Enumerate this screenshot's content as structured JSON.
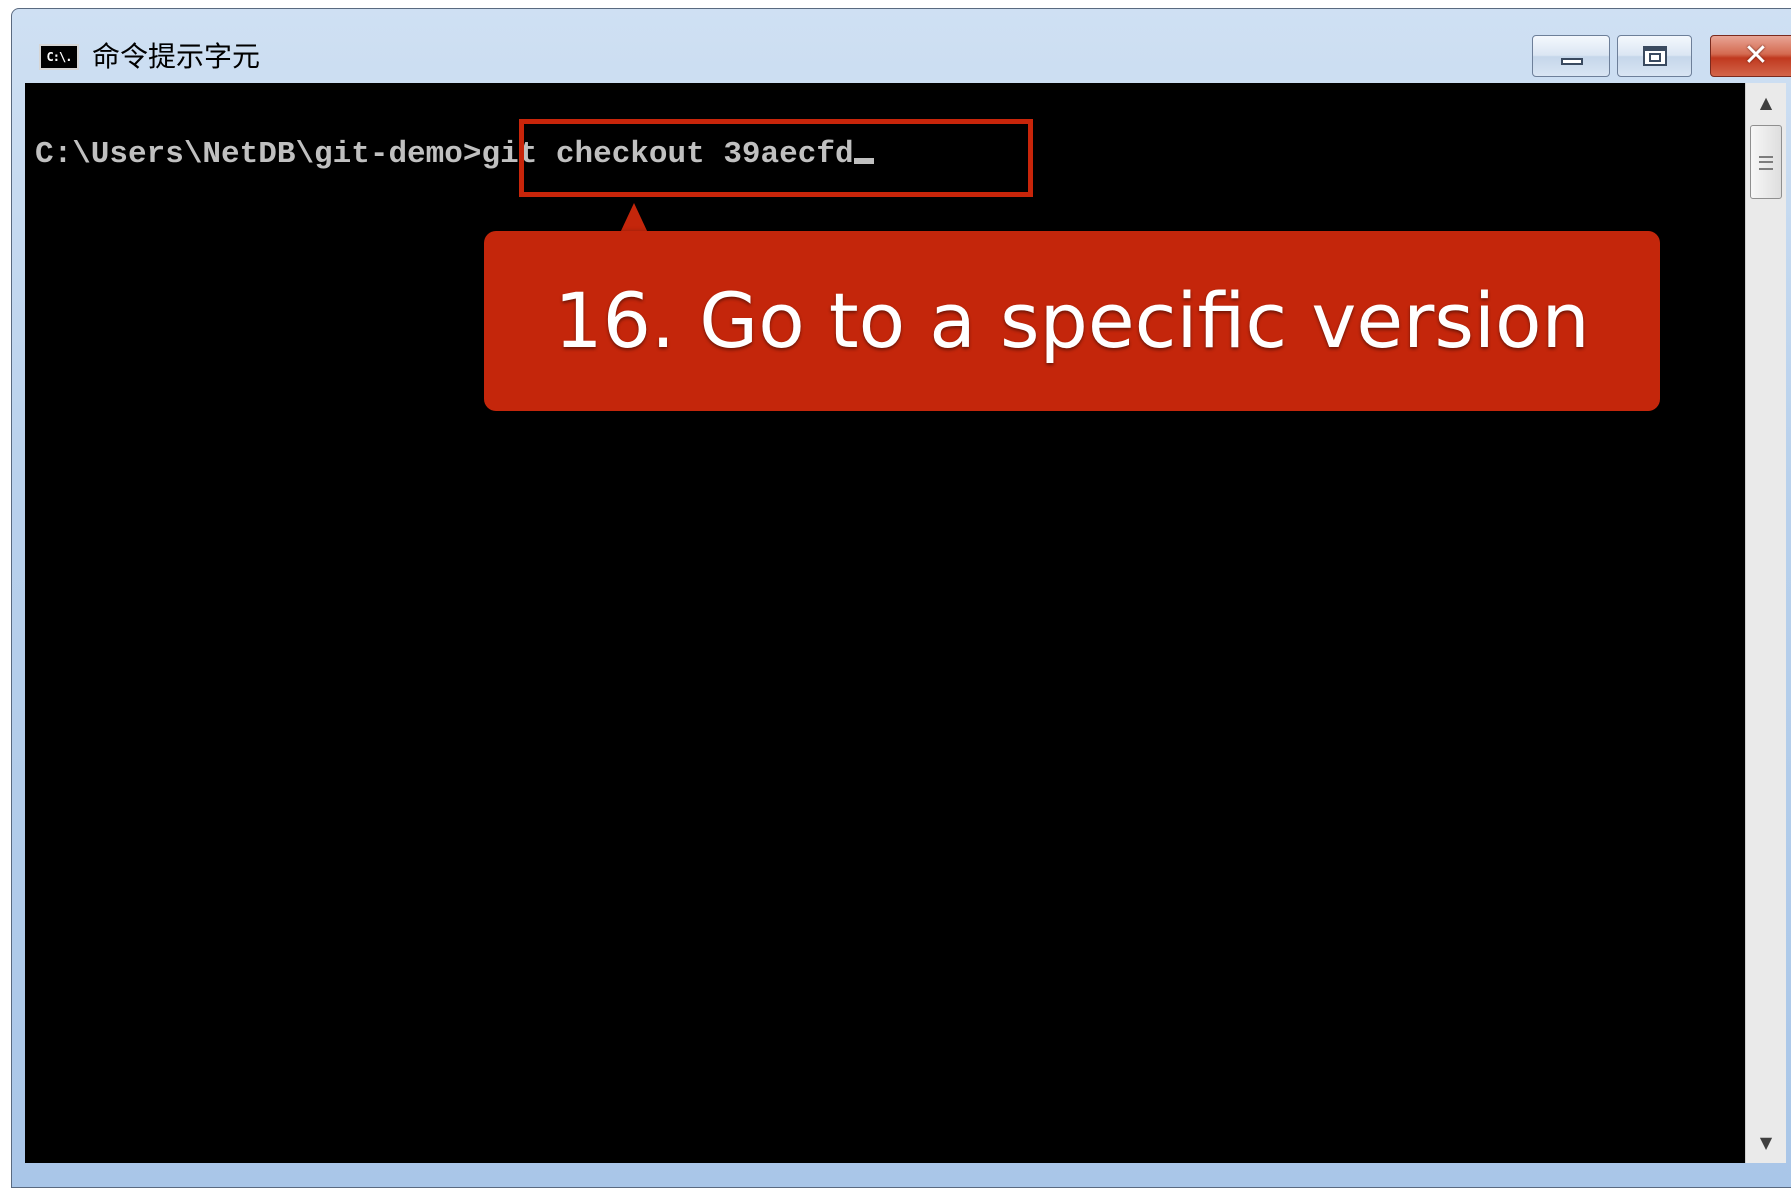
{
  "window": {
    "title": "命令提示字元",
    "icon_text": "C:\\.",
    "icon_name": "cmd-app-icon",
    "close_glyph": "✕"
  },
  "console": {
    "prompt": "C:\\Users\\NetDB\\git-demo",
    "command": "git checkout 39aecfd",
    "cursor": "_"
  },
  "callout": {
    "text": "16. Go to a specific version",
    "color": "#c4260b",
    "highlight_color": "#c8250a"
  },
  "scrollbar": {
    "up_arrow": "▲",
    "down_arrow": "▼"
  }
}
